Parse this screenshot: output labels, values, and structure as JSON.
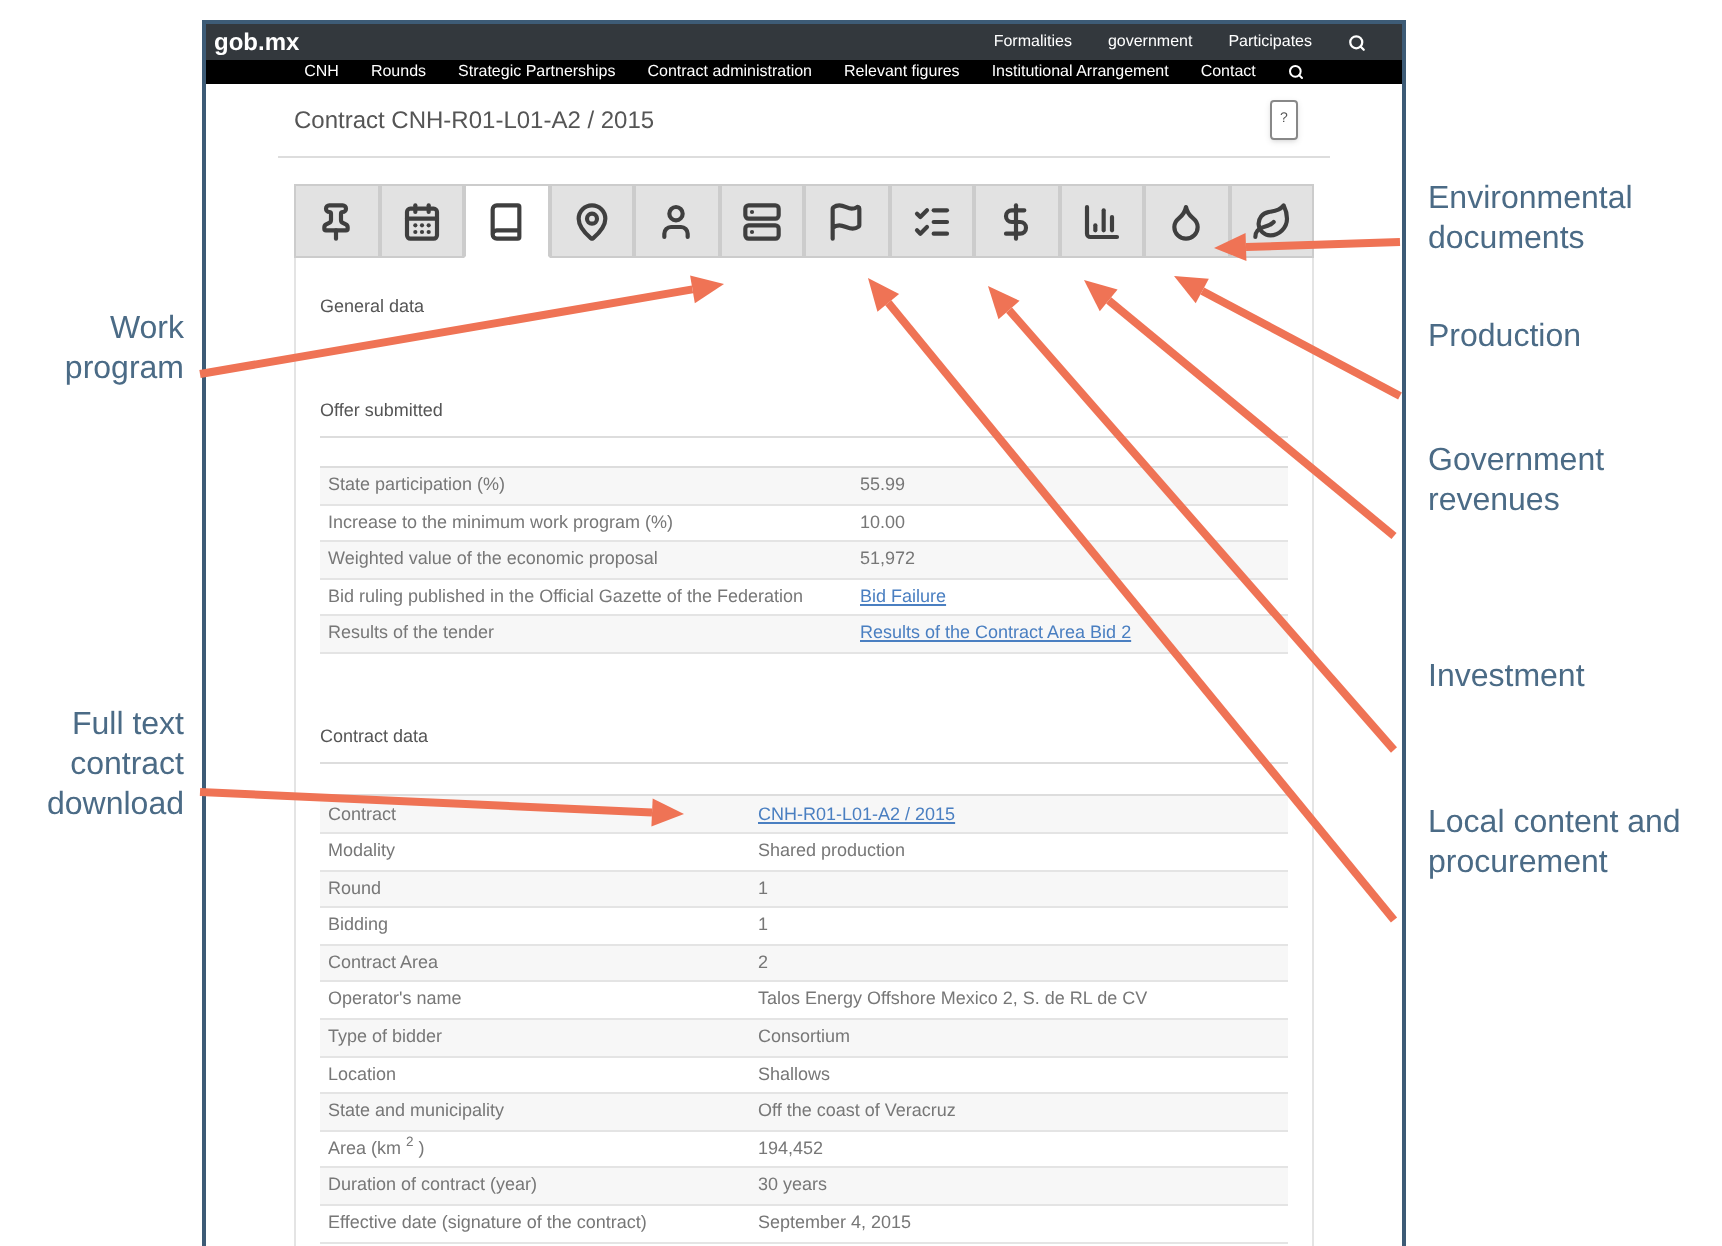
{
  "header": {
    "logo": "gob.mx",
    "links": [
      "Formalities",
      "government",
      "Participates"
    ]
  },
  "nav": {
    "items": [
      "CNH",
      "Rounds",
      "Strategic Partnerships",
      "Contract administration",
      "Relevant figures",
      "Institutional Arrangement",
      "Contact"
    ]
  },
  "page_title": "Contract CNH-R01-L01-A2 / 2015",
  "help_button": "?",
  "tabs": [
    {
      "selected": false
    },
    {
      "selected": false
    },
    {
      "selected": true
    },
    {
      "selected": false
    },
    {
      "selected": false
    },
    {
      "selected": false
    },
    {
      "selected": false
    },
    {
      "selected": false
    },
    {
      "selected": false
    },
    {
      "selected": false
    },
    {
      "selected": false
    },
    {
      "selected": false
    }
  ],
  "general_heading": "General data",
  "offer": {
    "heading": "Offer submitted",
    "rows": [
      {
        "label": "State participation (%)",
        "value": "55.99",
        "link": false
      },
      {
        "label": "Increase to the minimum work program (%)",
        "value": "10.00",
        "link": false
      },
      {
        "label": "Weighted value of the economic proposal",
        "value": "51,972",
        "link": false
      },
      {
        "label": "Bid ruling published in the Official Gazette of the Federation",
        "value": "Bid Failure",
        "link": true
      },
      {
        "label": "Results of the tender",
        "value": "Results of the Contract Area Bid 2",
        "link": true
      }
    ]
  },
  "contract": {
    "heading": "Contract data",
    "rows": [
      {
        "label": "Contract",
        "value": "CNH-R01-L01-A2 / 2015",
        "link": true
      },
      {
        "label": "Modality",
        "value": "Shared production",
        "link": false
      },
      {
        "label": "Round",
        "value": "1",
        "link": false
      },
      {
        "label": "Bidding",
        "value": "1",
        "link": false
      },
      {
        "label": "Contract Area",
        "value": "2",
        "link": false
      },
      {
        "label": "Operator's name",
        "value": "Talos Energy Offshore Mexico 2, S. de RL de CV",
        "link": false
      },
      {
        "label": "Type of bidder",
        "value": "Consortium",
        "link": false
      },
      {
        "label": "Location",
        "value": "Shallows",
        "link": false
      },
      {
        "label": "State and municipality",
        "value": "Off the coast of Veracruz",
        "link": false
      },
      {
        "label": "Area (km $^{2}$ )",
        "value": "194,452",
        "link": false
      },
      {
        "label": "Duration of contract (year)",
        "value": "30 years",
        "link": false
      },
      {
        "label": "Effective date (signature of the contract)",
        "value": "September 4, 2015",
        "link": false
      }
    ]
  },
  "annotations_left": [
    "Work program",
    "Full text contract download"
  ],
  "annotations_right": [
    "Environmental documents",
    "Production",
    "Government revenues",
    "Investment",
    "Local content and procurement"
  ]
}
